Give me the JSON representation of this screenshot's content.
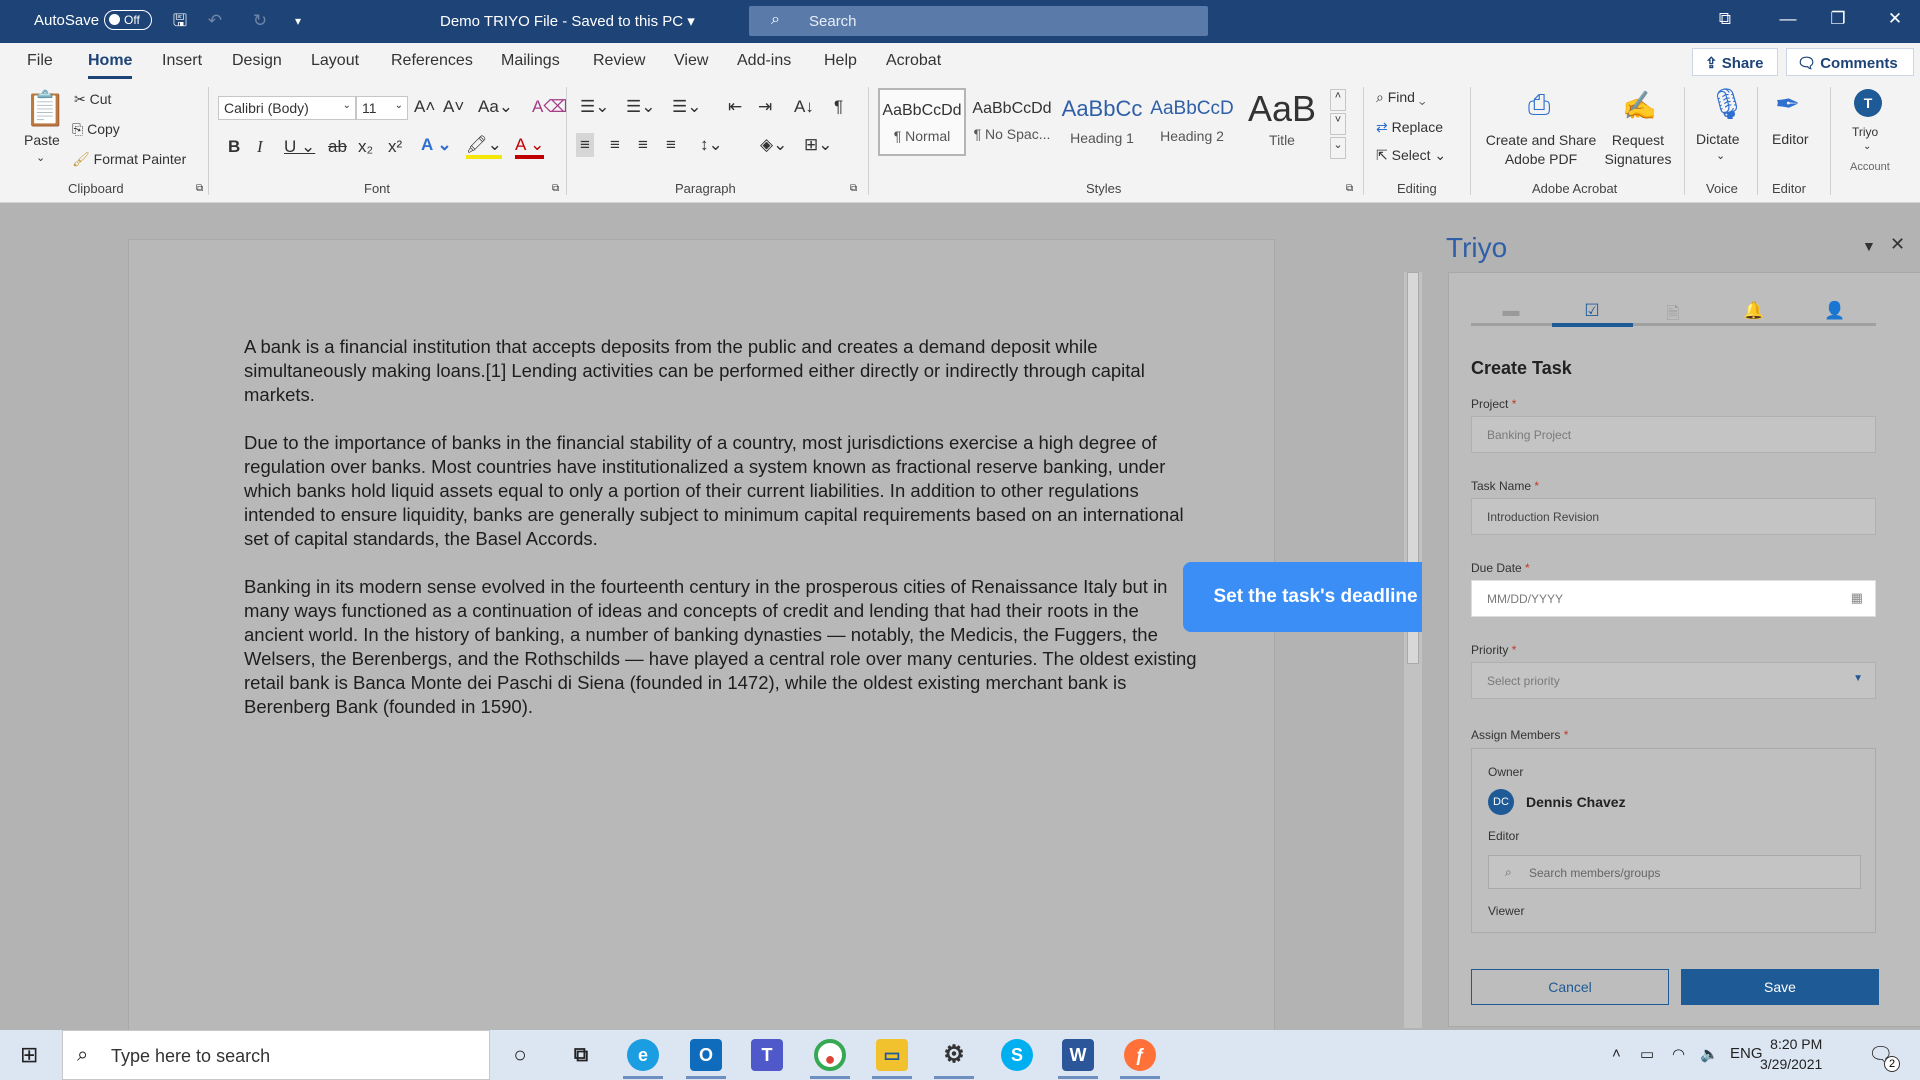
{
  "titlebar": {
    "autosave_label": "AutoSave",
    "autosave_state": "Off",
    "doc_title": "Demo TRIYO File  -  Saved to this PC",
    "search_placeholder": "Search"
  },
  "ribbon_tabs": [
    "File",
    "Home",
    "Insert",
    "Design",
    "Layout",
    "References",
    "Mailings",
    "Review",
    "View",
    "Add-ins",
    "Help",
    "Acrobat"
  ],
  "ribbon_actions": {
    "share": "Share",
    "comments": "Comments"
  },
  "clipboard": {
    "paste": "Paste",
    "cut": "Cut",
    "copy": "Copy",
    "format_painter": "Format Painter",
    "label": "Clipboard"
  },
  "font": {
    "name": "Calibri (Body)",
    "size": "11",
    "label": "Font"
  },
  "paragraph": {
    "label": "Paragraph"
  },
  "styles": {
    "items": [
      {
        "preview": "AaBbCcDd",
        "name": "¶ Normal"
      },
      {
        "preview": "AaBbCcDd",
        "name": "¶ No Spac..."
      },
      {
        "preview": "AaBbCc",
        "name": "Heading 1"
      },
      {
        "preview": "AaBbCcD",
        "name": "Heading 2"
      },
      {
        "preview": "AaB",
        "name": "Title"
      }
    ],
    "label": "Styles"
  },
  "editing": {
    "find": "Find",
    "replace": "Replace",
    "select": "Select",
    "label": "Editing"
  },
  "acrobat": {
    "create_share_1": "Create and Share",
    "create_share_2": "Adobe PDF",
    "request_1": "Request",
    "request_2": "Signatures",
    "label": "Adobe Acrobat"
  },
  "voice": {
    "dictate": "Dictate",
    "label": "Voice"
  },
  "editor": {
    "editor": "Editor",
    "label": "Editor"
  },
  "account": {
    "triyo": "Triyo",
    "label": "Account"
  },
  "document": {
    "paragraphs": [
      "A bank is a financial institution that accepts deposits from the public and creates a demand deposit while simultaneously making loans.[1] Lending activities can be performed either directly or indirectly through capital markets.",
      "Due to the importance of banks in the financial stability of a country, most jurisdictions exercise a high degree of regulation over banks. Most countries have institutionalized a system known as fractional reserve banking, under which banks hold liquid assets equal to only a portion of their current liabilities. In addition to other regulations intended to ensure liquidity, banks are generally subject to minimum capital requirements based on an international set of capital standards, the Basel Accords.",
      "Banking in its modern sense evolved in the fourteenth century in the prosperous cities of Renaissance Italy but in many ways functioned as a continuation of ideas and concepts of credit and lending that had their roots in the ancient world. In the history of banking, a number of banking dynasties — notably, the Medicis, the Fuggers, the Welsers, the Berenbergs, and the Rothschilds — have played a central role over many centuries. The oldest existing retail bank is Banca Monte dei Paschi di Siena (founded in 1472), while the oldest existing merchant bank is Berenberg Bank (founded in 1590)."
    ]
  },
  "tooltip": "Set the task's deadline",
  "pane": {
    "title": "Triyo",
    "form_title": "Create Task",
    "project_label": "Project",
    "project_value": "Banking Project",
    "task_name_label": "Task Name",
    "task_name_value": "Introduction Revision",
    "due_date_label": "Due Date",
    "due_date_placeholder": "MM/DD/YYYY",
    "priority_label": "Priority",
    "priority_placeholder": "Select priority",
    "assign_label": "Assign Members",
    "owner_label": "Owner",
    "owner_initials": "DC",
    "owner_name": "Dennis Chavez",
    "editor_label": "Editor",
    "member_search_placeholder": "Search members/groups",
    "viewer_label": "Viewer",
    "required_mark": "*",
    "cancel": "Cancel",
    "save": "Save"
  },
  "taskbar": {
    "search_placeholder": "Type here to search",
    "lang": "ENG",
    "time": "8:20 PM",
    "date": "3/29/2021",
    "notifications": "2"
  },
  "colors": {
    "titlebar": "#1e4377",
    "accent": "#1e5a96",
    "tooltip": "#3a8ef6"
  }
}
